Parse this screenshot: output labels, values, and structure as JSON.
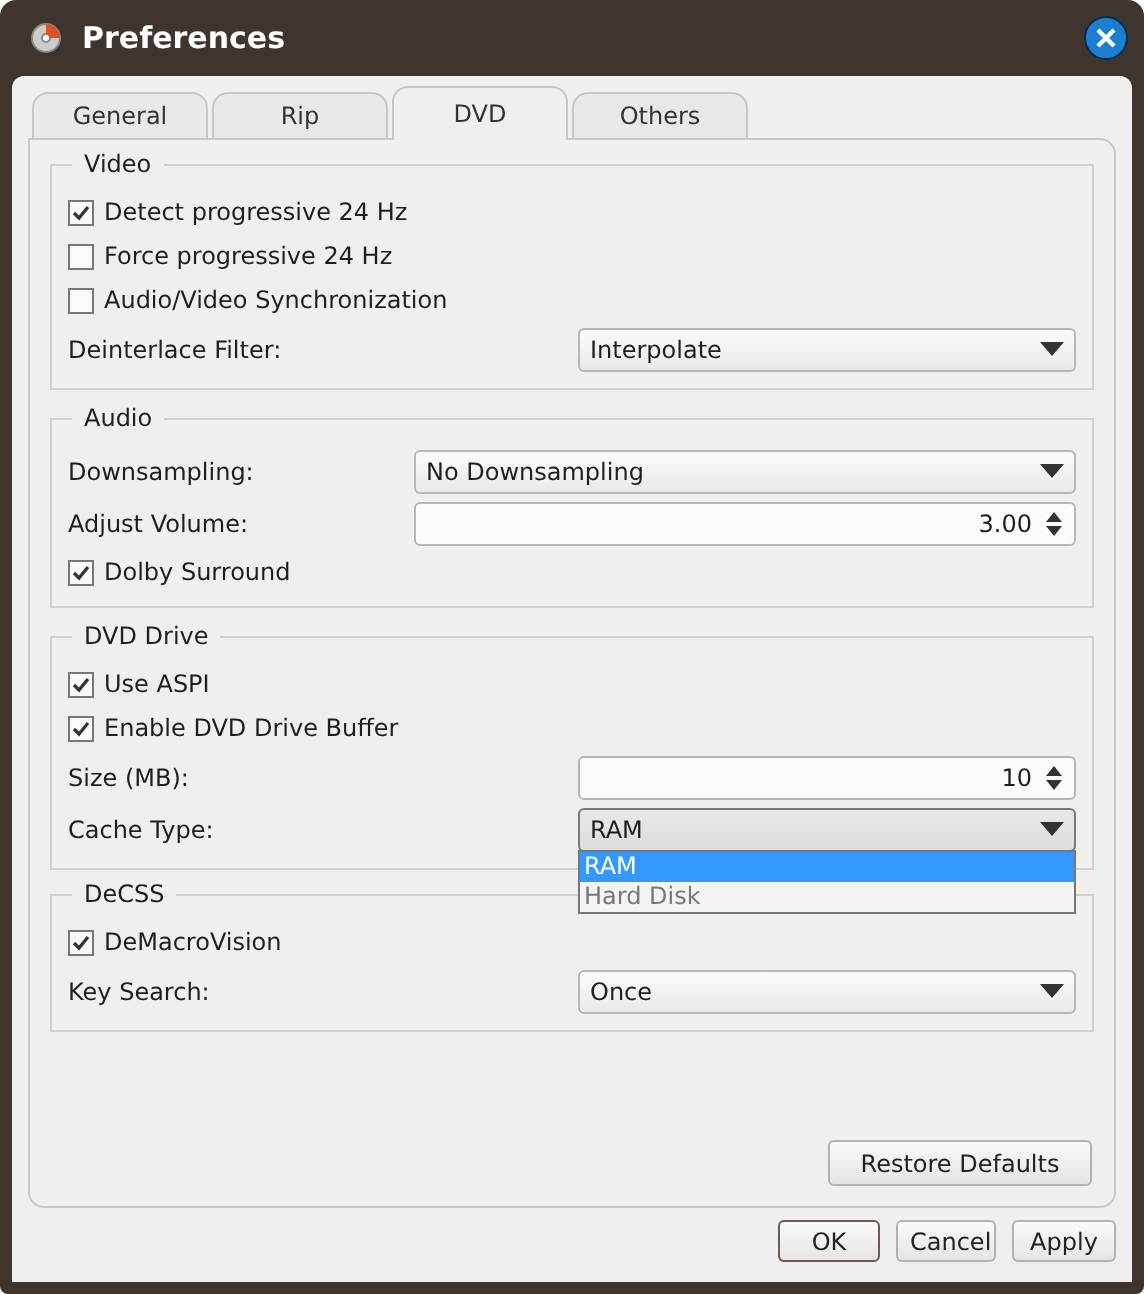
{
  "window": {
    "title": "Preferences"
  },
  "tabs": [
    {
      "label": "General",
      "selected": false
    },
    {
      "label": "Rip",
      "selected": false
    },
    {
      "label": "DVD",
      "selected": true
    },
    {
      "label": "Others",
      "selected": false
    }
  ],
  "groups": [
    {
      "title": "Video",
      "rows": [
        {
          "kind": "checkbox",
          "label": "Detect progressive 24 Hz",
          "checked": true
        },
        {
          "kind": "checkbox",
          "label": "Force progressive 24 Hz",
          "checked": false
        },
        {
          "kind": "checkbox",
          "label": "Audio/Video Synchronization",
          "checked": false
        },
        {
          "kind": "select",
          "label": "Deinterlace Filter:",
          "value": "Interpolate"
        }
      ]
    },
    {
      "title": "Audio",
      "rows": [
        {
          "kind": "select",
          "label": "Downsampling:",
          "value": "No Downsampling"
        },
        {
          "kind": "spin",
          "label": "Adjust Volume:",
          "value": "3.00"
        },
        {
          "kind": "checkbox",
          "label": "Dolby Surround",
          "checked": true
        }
      ]
    },
    {
      "title": "DVD Drive",
      "rows": [
        {
          "kind": "checkbox",
          "label": "Use ASPI",
          "checked": true
        },
        {
          "kind": "checkbox",
          "label": "Enable DVD Drive Buffer",
          "checked": true
        },
        {
          "kind": "spin",
          "label": "Size (MB):",
          "value": "10"
        },
        {
          "kind": "select",
          "label": "Cache Type:",
          "value": "RAM",
          "expanded": true,
          "options": [
            {
              "label": "RAM",
              "selected": true
            },
            {
              "label": "Hard Disk",
              "selected": false
            }
          ]
        }
      ]
    },
    {
      "title": "DeCSS",
      "rows": [
        {
          "kind": "checkbox",
          "label": "DeMacroVision",
          "checked": true
        },
        {
          "kind": "select",
          "label": "Key Search:",
          "value": "Once"
        }
      ]
    }
  ],
  "restore_button": "Restore Defaults",
  "buttons": [
    {
      "label": "OK",
      "default": true
    },
    {
      "label": "Cancel",
      "default": false
    },
    {
      "label": "Apply",
      "default": false
    }
  ]
}
